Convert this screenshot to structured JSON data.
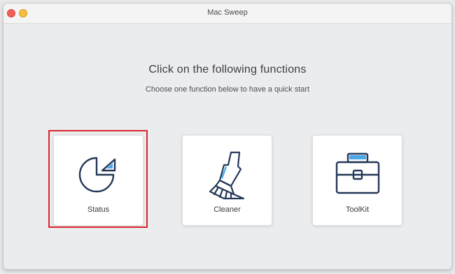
{
  "window": {
    "title": "Mac Sweep"
  },
  "main": {
    "heading": "Click on the following functions",
    "subheading": "Choose one function below to have a quick start",
    "cards": [
      {
        "label": "Status",
        "icon": "pie-chart-icon",
        "highlighted": true
      },
      {
        "label": "Cleaner",
        "icon": "brush-icon"
      },
      {
        "label": "ToolKit",
        "icon": "toolbox-icon"
      }
    ]
  },
  "colors": {
    "icon_stroke": "#253858",
    "icon_accent": "#4aa8e8",
    "highlight": "#d9262c",
    "close_button": "#f05f57",
    "minimize_button": "#f6bd3a"
  }
}
